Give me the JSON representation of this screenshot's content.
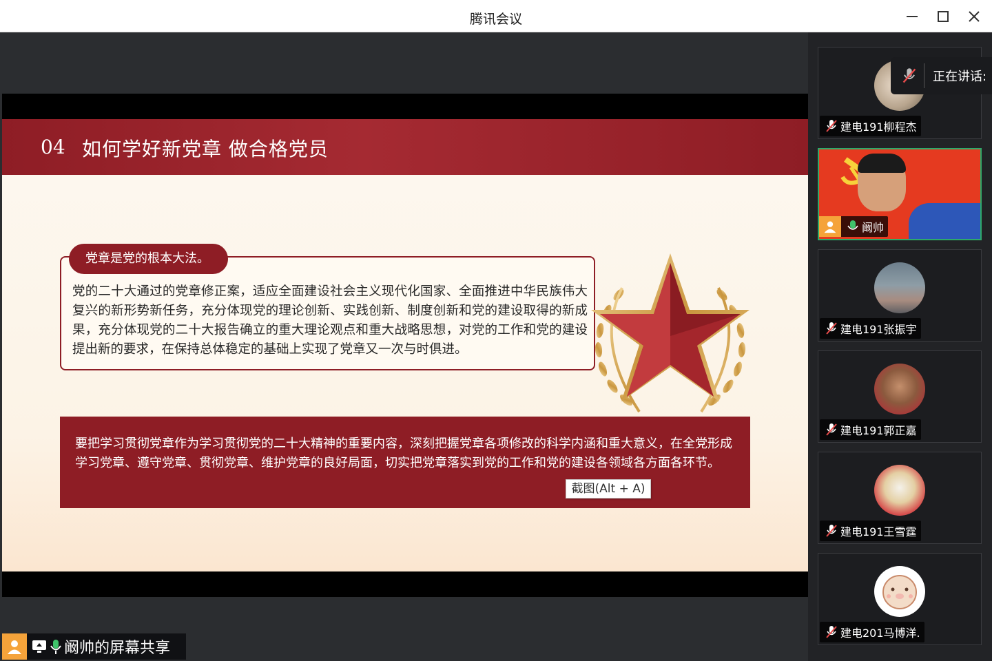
{
  "window": {
    "title": "腾讯会议"
  },
  "slide": {
    "section_number": "04",
    "section_title": "如何学好新党章  做合格党员",
    "pill_label": "党章是党的根本大法。",
    "paragraph1": "党的二十大通过的党章修正案，适应全面建设社会主义现代化国家、全面推进中华民族伟大复兴的新形势新任务，充分体现党的理论创新、实践创新、制度创新和党的建设取得的新成果，充分体现党的二十大报告确立的重大理论观点和重大战略思想，对党的工作和党的建设提出新的要求，在保持总体稳定的基础上实现了党章又一次与时俱进。",
    "paragraph2": "要把学习贯彻党章作为学习贯彻党的二十大精神的重要内容，深刻把握党章各项修改的科学内涵和重大意义，在全党形成学习党章、遵守党章、贯彻党章、维护党章的良好局面，切实把党章落实到党的工作和党的建设各领域各方面各环节。"
  },
  "tooltip": {
    "text": "截图(Alt + A)"
  },
  "share_bar": {
    "label": "阚帅的屏幕共享"
  },
  "speaking": {
    "label": "正在讲话:"
  },
  "participants": [
    {
      "name": "建电191柳程杰",
      "mic": "muted"
    },
    {
      "name": "阚帅",
      "mic": "on",
      "active": true
    },
    {
      "name": "建电191张振宇",
      "mic": "muted"
    },
    {
      "name": "建电191郭正嘉",
      "mic": "muted"
    },
    {
      "name": "建电191王雪霆",
      "mic": "muted"
    },
    {
      "name": "建电201马博洋.",
      "mic": "muted"
    }
  ],
  "colors": {
    "party_red": "#8e1d25",
    "active_border": "#2eaa6a",
    "avatar_orange": "#f5a33a",
    "mic_green": "#3fc36a"
  },
  "icons": [
    "minimize-icon",
    "maximize-icon",
    "close-icon",
    "mic-muted-icon",
    "mic-on-icon",
    "user-icon",
    "screen-share-icon",
    "star-laurel-emblem",
    "hammer-sickle-icon"
  ]
}
